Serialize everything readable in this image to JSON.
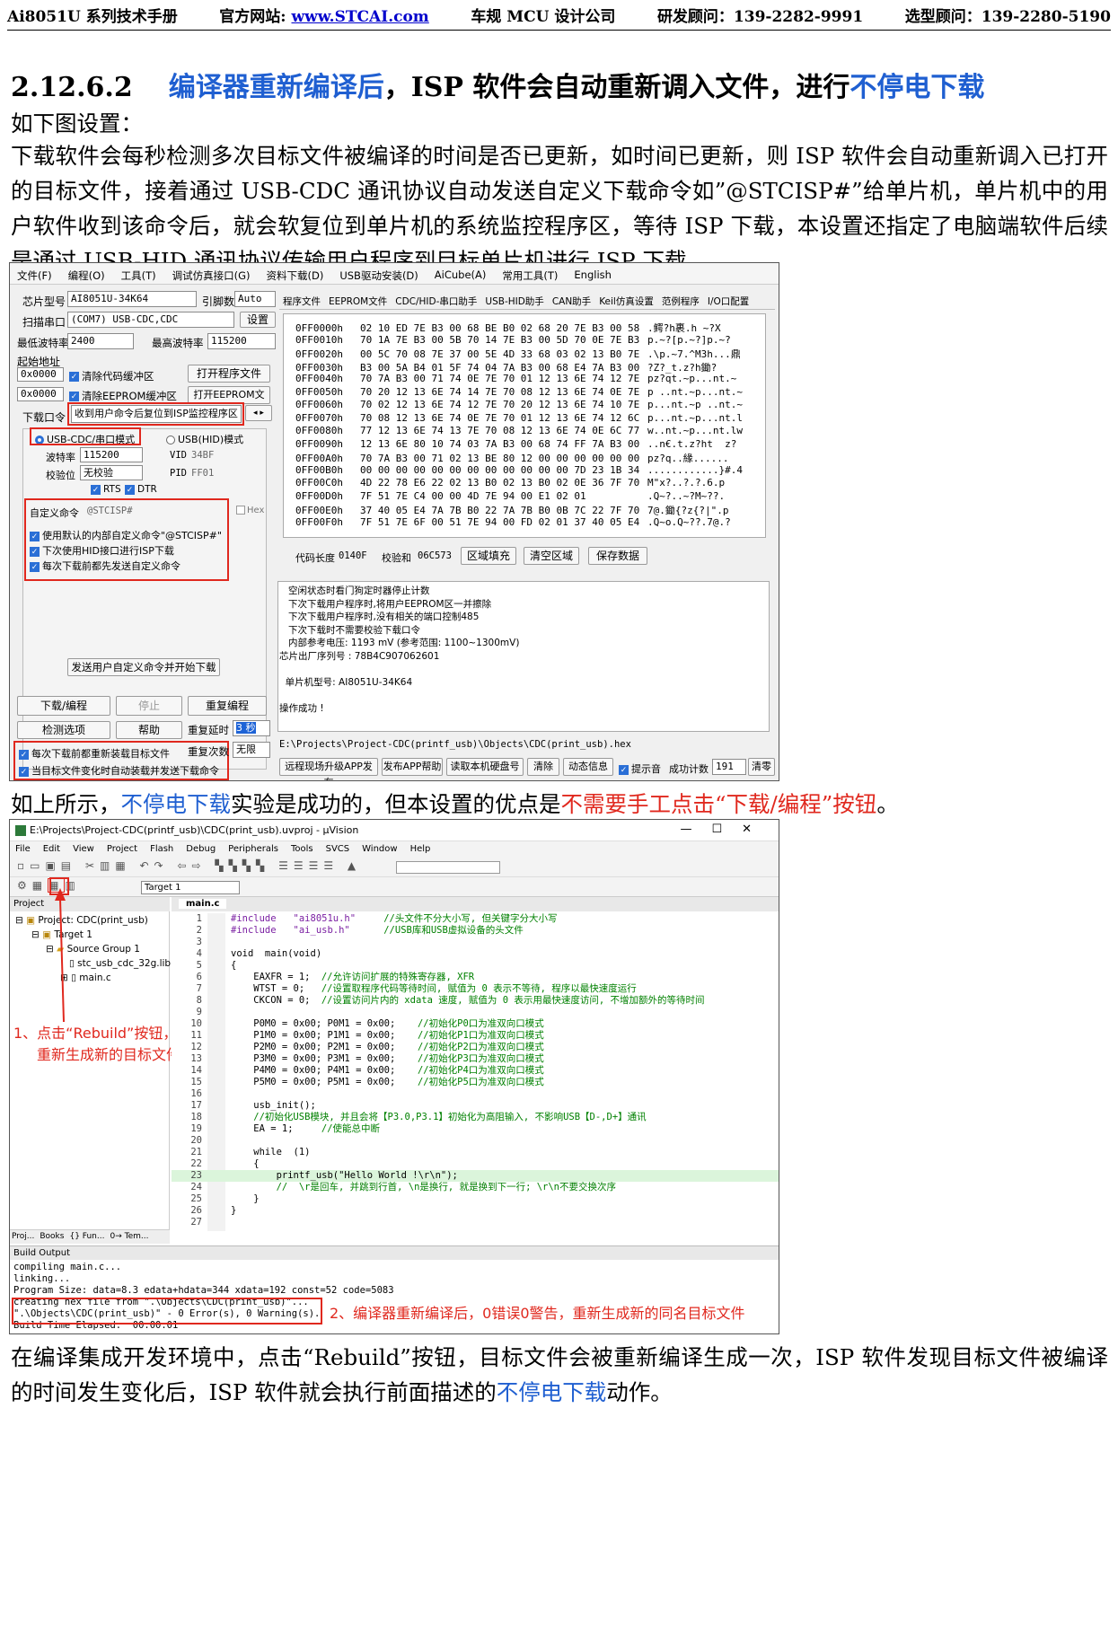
{
  "header": {
    "left": "Ai8051U 系列技术手册",
    "website_label": "官方网站: ",
    "website": "www.STCAI.com",
    "company": "车规 MCU 设计公司",
    "rd": "研发顾问：139-2282-9991",
    "sel": "选型顾问：139-2280-5190"
  },
  "section": {
    "number": "2.12.6.2",
    "title_blue": "编译器重新编译后",
    "title_mid": "，ISP 软件会自动重新调入文件，进行",
    "title_blue2": "不停电下载"
  },
  "intro": "如下图设置：",
  "para1": "下载软件会每秒检测多次目标文件被编译的时间是否已更新，如时间已更新，则 ISP 软件会自动重新调入已打开的目标文件，接着通过 USB-CDC 通讯协议自动发送自定义下载命令如”@STCISP#”给单片机，单片机中的用户软件收到该命令后，就会软复位到单片机的系统监控程序区，等待 ISP 下载，本设置还指定了电脑端软件后续是通过 USB-HID 通讯协议传输用户程序到目标单片机进行 ISP 下载。",
  "isp": {
    "menu": [
      "文件(F)",
      "编程(O)",
      "工具(T)",
      "调试仿真接口(G)",
      "资料下载(D)",
      "USB驱动安装(D)",
      "AiCube(A)",
      "常用工具(T)",
      "English"
    ],
    "chip_label": "芯片型号",
    "chip_value": "AI8051U-34K64",
    "pin_label": "引脚数",
    "pin_value": "Auto",
    "scan_label": "扫描串口",
    "scan_value": "(COM7) USB-CDC,CDC",
    "settings": "设置",
    "min_baud_label": "最低波特率",
    "min_baud": "2400",
    "max_baud_label": "最高波特率",
    "max_baud": "115200",
    "start_addr": "起始地址",
    "addr1": "0x0000",
    "clear_code": "清除代码缓冲区",
    "open_prog": "打开程序文件",
    "addr2": "0x0000",
    "clear_eeprom": "清除EEPROM缓冲区",
    "open_eeprom": "打开EEPROM文件",
    "download_cmd_label": "下载口令",
    "download_cmd_value": "收到用户命令后复位到ISP监控程序区",
    "mode_cdc": "USB-CDC/串口模式",
    "mode_hid": "USB(HID)模式",
    "baud_label": "波特率",
    "baud_value": "115200",
    "vid_label": "VID",
    "vid_value": "34BF",
    "parity_label": "校验位",
    "parity_value": "无校验",
    "pid_label": "PID",
    "pid_value": "FF01",
    "rts": "RTS",
    "dtr": "DTR",
    "custom_cmd_label": "自定义命令",
    "custom_cmd_value": "@STCISP#",
    "hex": "Hex",
    "opt1": "使用默认的内部自定义命令\"@STCISP#\"",
    "opt2": "下次使用HID接口进行ISP下载",
    "opt3": "每次下载前都先发送自定义命令",
    "send_btn": "发送用户自定义命令并开始下载",
    "dl_btn": "下载/编程",
    "stop_btn": "停止",
    "redo_btn": "重复编程",
    "detect_btn": "检测选项",
    "help_btn": "帮助",
    "delay_label": "重复延时",
    "delay_value": "3 秒",
    "chk_reload": "每次下载前都重新装载目标文件",
    "repeat_label": "重复次数",
    "repeat_value": "无限",
    "chk_auto": "当目标文件变化时自动装载并发送下载命令",
    "tabs": [
      "程序文件",
      "EEPROM文件",
      "CDC/HID-串口助手",
      "USB-HID助手",
      "CAN助手",
      "Keil仿真设置",
      "范例程序",
      "I/O口配置"
    ],
    "hex_rows": [
      [
        "0FF0000h",
        "02 10 ED 7E B3 00 68 BE B0 02 68 20 7E B3 00 58",
        ".鳄?h裹.h ~?X"
      ],
      [
        "0FF0010h",
        "70 1A 7E B3 00 5B 70 14 7E B3 00 5D 70 0E 7E B3",
        "p.~?[p.~?]p.~?"
      ],
      [
        "0FF0020h",
        "00 5C 70 08 7E 37 00 5E 4D 33 68 03 02 13 B0 7E",
        ".\\p.~7.^M3h...鼎"
      ],
      [
        "0FF0030h",
        "B3 00 5A B4 01 5F 74 04 7A B3 00 68 E4 7A B3 00",
        "?Z?_t.z?h鋤?"
      ],
      [
        "0FF0040h",
        "70 7A B3 00 71 74 0E 7E 70 01 12 13 6E 74 12 7E",
        "pz?qt.~p...nt.~"
      ],
      [
        "0FF0050h",
        "70 20 12 13 6E 74 14 7E 70 08 12 13 6E 74 0E 7E",
        "p ..nt.~p...nt.~"
      ],
      [
        "0FF0060h",
        "70 02 12 13 6E 74 12 7E 70 20 12 13 6E 74 10 7E",
        "p...nt.~p ..nt.~"
      ],
      [
        "0FF0070h",
        "70 08 12 13 6E 74 0E 7E 70 01 12 13 6E 74 12 6C",
        "p...nt.~p...nt.l"
      ],
      [
        "0FF0080h",
        "77 12 13 6E 74 13 7E 70 08 12 13 6E 74 0E 6C 77",
        "w..nt.~p...nt.lw"
      ],
      [
        "0FF0090h",
        "12 13 6E 80 10 74 03 7A B3 00 68 74 FF 7A B3 00",
        "..n€.t.z?ht  z?"
      ],
      [
        "0FF00A0h",
        "70 7A B3 00 71 02 13 BE 80 12 00 00 00 00 00 00",
        "pz?q..緣......"
      ],
      [
        "0FF00B0h",
        "00 00 00 00 00 00 00 00 00 00 00 00 7D 23 1B 34",
        "............}#.4"
      ],
      [
        "0FF00C0h",
        "4D 22 78 E6 22 02 13 B0 02 13 B0 02 0E 36 7F 70",
        "M\"x?..?.?.6.p"
      ],
      [
        "0FF00D0h",
        "7F 51 7E C4 00 00 4D 7E 94 00 E1 02 01 ",
        ".Q~?..~?M~??."
      ],
      [
        "0FF00E0h",
        "37 40 05 E4 7A 7B B0 22 7A 7B B0 0B 7C 22 7F 70",
        "7@.鋤{?z{?|\".p"
      ],
      [
        "0FF00F0h",
        "7F 51 7E 6F 00 51 7E 94 00 FD 02 01 37 40 05 E4",
        ".Q~o.Q~??.7@.?"
      ]
    ],
    "code_len_label": "代码长度",
    "code_len": "0140F",
    "checksum_label": "校验和",
    "checksum": "06C573",
    "fill_btn": "区域填充",
    "clear_btn": "清空区域",
    "save_btn": "保存数据",
    "log": [
      "   空闲状态时看门狗定时器停止计数",
      "   下次下载用户程序时,将用户EEPROM区一并擦除",
      "   下次下载用户程序时,没有相关的端口控制485",
      "   下次下载时不需要校验下载口令",
      "   内部参考电压: 1193 mV (参考范围: 1100~1300mV)",
      "芯片出厂序列号 : 78B4C907062601",
      "",
      "  单片机型号: AI8051U-34K64",
      "",
      "操作成功 !"
    ],
    "path": "E:\\Projects\\Project-CDC(printf_usb)\\Objects\\CDC(print_usb).hex",
    "bottom_btns": [
      "远程现场升级APP发布",
      "发布APP帮助",
      "读取本机硬盘号",
      "清除",
      "动态信息"
    ],
    "chk_prompt": "提示音",
    "count_label": "成功计数",
    "count_value": "191",
    "clear_count": "清零"
  },
  "caption1_a": "如上所示，",
  "caption1_b": "不停电下载",
  "caption1_c": "实验是成功的，但本设置的优点是",
  "caption1_d": "不需要手工点击“下载/编程”按钮",
  "caption1_e": "。",
  "keil": {
    "title": "E:\\Projects\\Project-CDC(printf_usb)\\CDC(print_usb).uvproj - µVision",
    "menu": [
      "File",
      "Edit",
      "View",
      "Project",
      "Flash",
      "Debug",
      "Peripherals",
      "Tools",
      "SVCS",
      "Window",
      "Help"
    ],
    "target": "Target 1",
    "project_label": "Project",
    "tree": [
      "Project: CDC(print_usb)",
      "Target 1",
      "Source Group 1",
      "stc_usb_cdc_32g.lib",
      "main.c"
    ],
    "bottom_tabs": [
      "Proj...",
      "Books",
      "{} Fun...",
      "0→ Tem..."
    ],
    "editor_tab": "main.c",
    "annotation1_line1": "1、点击“Rebuild”按钮，",
    "annotation1_line2": "重新生成新的目标文件",
    "code": [
      [
        "1",
        "#include   \"ai8051u.h\"",
        "     //头文件不分大小写, 但关键字分大小写"
      ],
      [
        "2",
        "#include   \"ai_usb.h\"",
        "      //USB库和USB虚拟设备的头文件"
      ],
      [
        "3",
        "",
        ""
      ],
      [
        "4",
        "void  main(void)",
        ""
      ],
      [
        "5",
        "{",
        ""
      ],
      [
        "6",
        "    EAXFR = 1;",
        "  //允许访问扩展的特殊寄存器, XFR"
      ],
      [
        "7",
        "    WTST = 0;",
        "   //设置取程序代码等待时间, 赋值为 0 表示不等待, 程序以最快速度运行"
      ],
      [
        "8",
        "    CKCON = 0;",
        "  //设置访问片内的 xdata 速度, 赋值为 0 表示用最快速度访问, 不增加额外的等待时间"
      ],
      [
        "9",
        "",
        ""
      ],
      [
        "10",
        "    P0M0 = 0x00; P0M1 = 0x00;",
        "    //初始化P0口为准双向口模式"
      ],
      [
        "11",
        "    P1M0 = 0x00; P1M1 = 0x00;",
        "    //初始化P1口为准双向口模式"
      ],
      [
        "12",
        "    P2M0 = 0x00; P2M1 = 0x00;",
        "    //初始化P2口为准双向口模式"
      ],
      [
        "13",
        "    P3M0 = 0x00; P3M1 = 0x00;",
        "    //初始化P3口为准双向口模式"
      ],
      [
        "14",
        "    P4M0 = 0x00; P4M1 = 0x00;",
        "    //初始化P4口为准双向口模式"
      ],
      [
        "15",
        "    P5M0 = 0x00; P5M1 = 0x00;",
        "    //初始化P5口为准双向口模式"
      ],
      [
        "16",
        "",
        ""
      ],
      [
        "17",
        "    usb_init();",
        ""
      ],
      [
        "18",
        "",
        "    //初始化USB模块, 并且会将【P3.0,P3.1】初始化为高阻输入, 不影响USB【D-,D+】通讯"
      ],
      [
        "19",
        "    EA = 1;",
        "     //使能总中断"
      ],
      [
        "20",
        "",
        ""
      ],
      [
        "21",
        "    while  (1)",
        ""
      ],
      [
        "22",
        "    {",
        ""
      ],
      [
        "23",
        "        printf_usb(\"Hello World !\\r\\n\");",
        ""
      ],
      [
        "24",
        "",
        "        //  \\r是回车, 并跳到行首, \\n是换行, 就是换到下一行; \\r\\n不要交换次序"
      ],
      [
        "25",
        "    }",
        ""
      ],
      [
        "26",
        "}",
        ""
      ],
      [
        "27",
        "",
        ""
      ]
    ],
    "build_label": "Build Output",
    "build": [
      "compiling main.c...",
      "linking...",
      "Program Size: data=8.3 edata+hdata=344 xdata=192 const=52 code=5083",
      "creating hex file from \".\\Objects\\CDC(print_usb)\"...",
      "\".\\Objects\\CDC(print_usb)\" - 0 Error(s), 0 Warning(s).",
      "Build Time Elapsed:  00:00:01"
    ],
    "annotation2": "2、编译器重新编译后，0错误0警告，重新生成新的同名目标文件"
  },
  "para2_a": "在编译集成开发环境中，点击“Rebuild”按钮，目标文件会被重新编译生成一次，ISP 软件发现目标文件被编译的时间发生变化后，ISP 软件就会执行前面描述的",
  "para2_b": "不停电下载",
  "para2_c": "动作。",
  "colors": {
    "blue": "#1f5fd1",
    "red": "#e0281e"
  }
}
